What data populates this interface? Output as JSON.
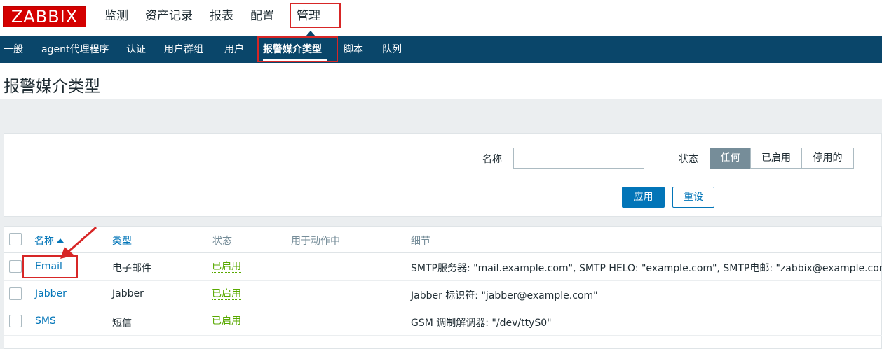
{
  "logo": "ZABBIX",
  "top_menu": {
    "items": [
      "监测",
      "资产记录",
      "报表",
      "配置"
    ],
    "active": "管理"
  },
  "sub_nav": {
    "items": [
      "一般",
      "agent代理程序",
      "认证",
      "用户群组",
      "用户",
      "报警媒介类型",
      "脚本",
      "队列"
    ],
    "active_index": 5
  },
  "page_title": "报警媒介类型",
  "filter": {
    "name_label": "名称",
    "name_value": "",
    "status_label": "状态",
    "status_options": [
      "任何",
      "已启用",
      "停用的"
    ],
    "status_selected": "任何",
    "apply_label": "应用",
    "reset_label": "重设"
  },
  "table": {
    "columns": [
      "名称",
      "类型",
      "状态",
      "用于动作中",
      "细节"
    ],
    "sort_column": "名称",
    "rows": [
      {
        "name": "Email",
        "type": "电子邮件",
        "status": "已启用",
        "used_in_actions": "",
        "details": "SMTP服务器: \"mail.example.com\", SMTP HELO: \"example.com\", SMTP电邮: \"zabbix@example.com\""
      },
      {
        "name": "Jabber",
        "type": "Jabber",
        "status": "已启用",
        "used_in_actions": "",
        "details": "Jabber 标识符: \"jabber@example.com\""
      },
      {
        "name": "SMS",
        "type": "短信",
        "status": "已启用",
        "used_in_actions": "",
        "details": "GSM 调制解调器: \"/dev/ttyS0\""
      }
    ]
  },
  "colors": {
    "brand_red": "#d40000",
    "nav_bg": "#0a466a",
    "link_blue": "#0275b8",
    "enabled_green": "#59a900",
    "annotation_red": "#d72626"
  }
}
